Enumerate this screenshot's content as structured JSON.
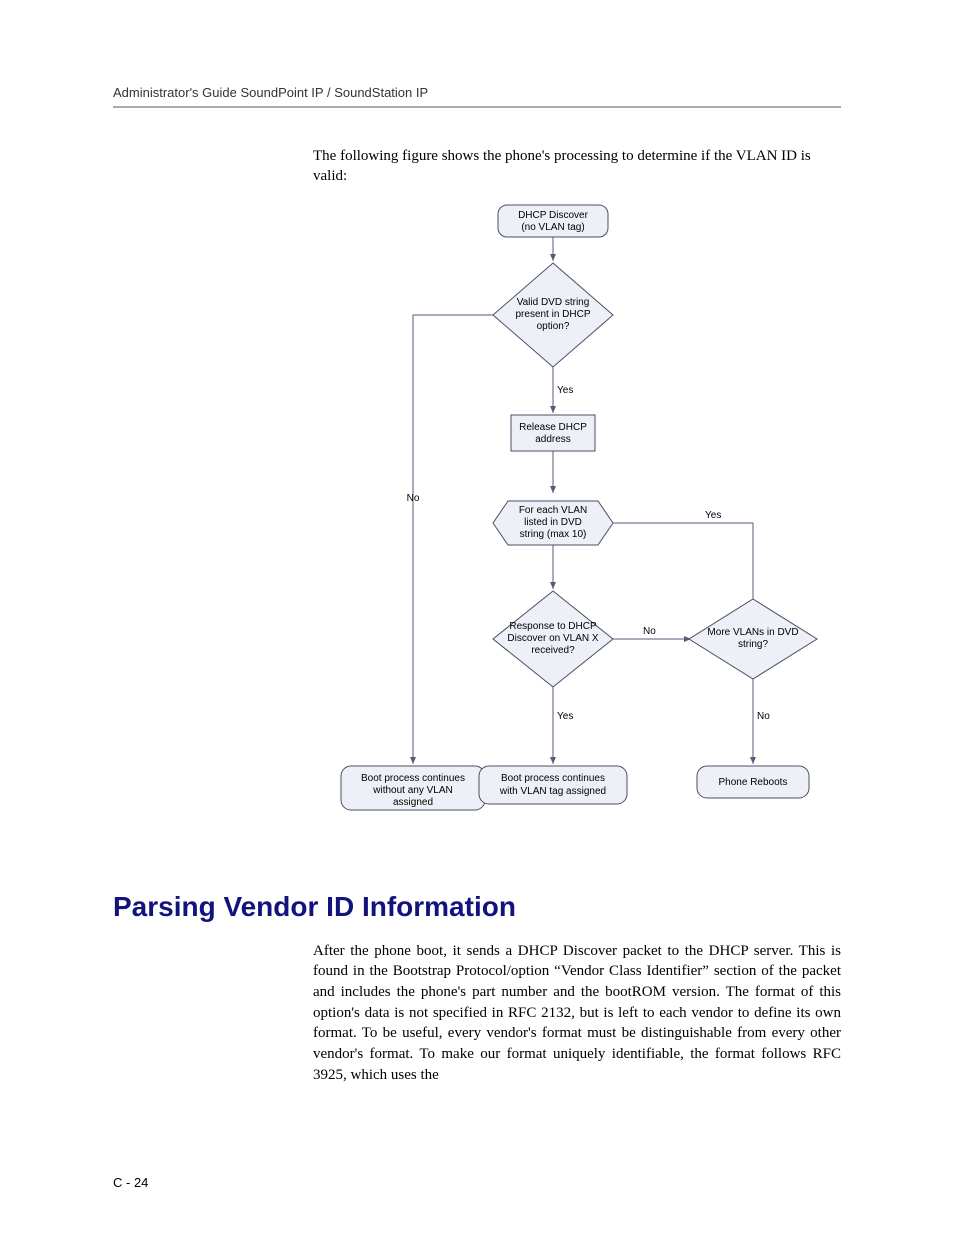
{
  "header": "Administrator's Guide SoundPoint IP / SoundStation IP",
  "intro": "The following figure shows the phone's processing to determine if the VLAN ID is valid:",
  "flowchart": {
    "start": "DHCP Discover\n(no VLAN tag)",
    "decision1": "Valid DVD string\npresent in DHCP\noption?",
    "d1_yes": "Yes",
    "d1_no": "No",
    "step_release": "Release DHCP\naddress",
    "step_foreach": "For each VLAN\nlisted in DVD\nstring (max 10)",
    "foreach_side": "Yes",
    "decision2": "Response to DHCP\nDiscover on VLAN X\nreceived?",
    "d2_yes": "Yes",
    "d2_no": "No",
    "decision3": "More VLANs in DVD\nstring?",
    "d3_no": "No",
    "end_no_vlan": "Boot process continues\nwithout any VLAN\nassigned",
    "end_with_vlan": "Boot process continues\nwith VLAN tag assigned",
    "end_reboot": "Phone Reboots"
  },
  "section_heading": "Parsing Vendor ID Information",
  "body": "After the phone boot, it sends a DHCP Discover packet to the DHCP server. This is found in the Bootstrap Protocol/option “Vendor Class Identifier” section of the packet and includes the phone's part number and the bootROM version. The format of this option's data is not specified in RFC 2132, but is left to each vendor to define its own format. To be useful, every vendor's format must be distinguishable from every other vendor's format. To make our format uniquely identifiable, the format follows RFC 3925, which uses the",
  "footer": "C - 24"
}
